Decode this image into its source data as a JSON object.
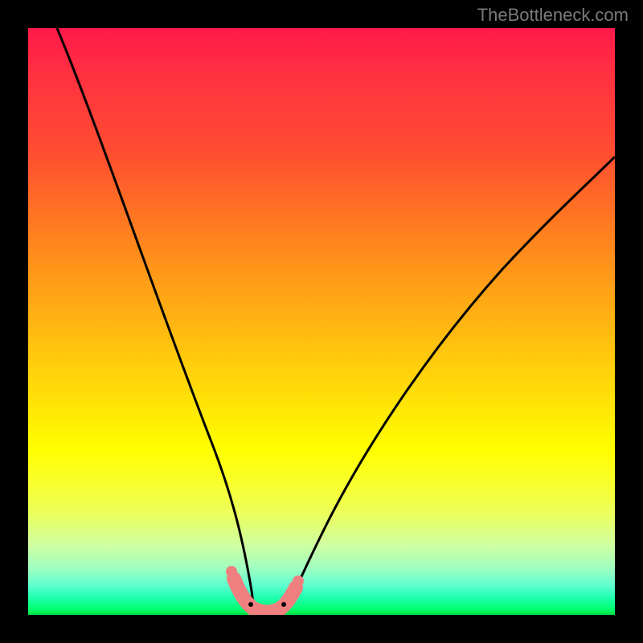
{
  "watermark": "TheBottleneck.com",
  "chart_data": {
    "type": "line",
    "title": "",
    "xlabel": "",
    "ylabel": "",
    "xlim": [
      0,
      100
    ],
    "ylim": [
      0,
      100
    ],
    "series": [
      {
        "name": "left-curve",
        "x": [
          5,
          10,
          15,
          20,
          25,
          30,
          33,
          35,
          37,
          38.5
        ],
        "y": [
          100,
          82,
          65,
          49,
          34,
          20,
          12,
          7,
          3,
          0.5
        ]
      },
      {
        "name": "right-curve",
        "x": [
          44,
          46,
          50,
          55,
          62,
          70,
          80,
          90,
          100
        ],
        "y": [
          1,
          3.5,
          9,
          18,
          29,
          40,
          52,
          62,
          70
        ]
      },
      {
        "name": "bottom-pink-segment",
        "x": [
          35,
          36.5,
          38,
          40,
          42,
          44,
          45.5
        ],
        "y": [
          6,
          3,
          1,
          0.5,
          0.5,
          2,
          4
        ]
      }
    ],
    "colors": {
      "curve": "#000000",
      "pink_marker": "#f08080"
    }
  }
}
